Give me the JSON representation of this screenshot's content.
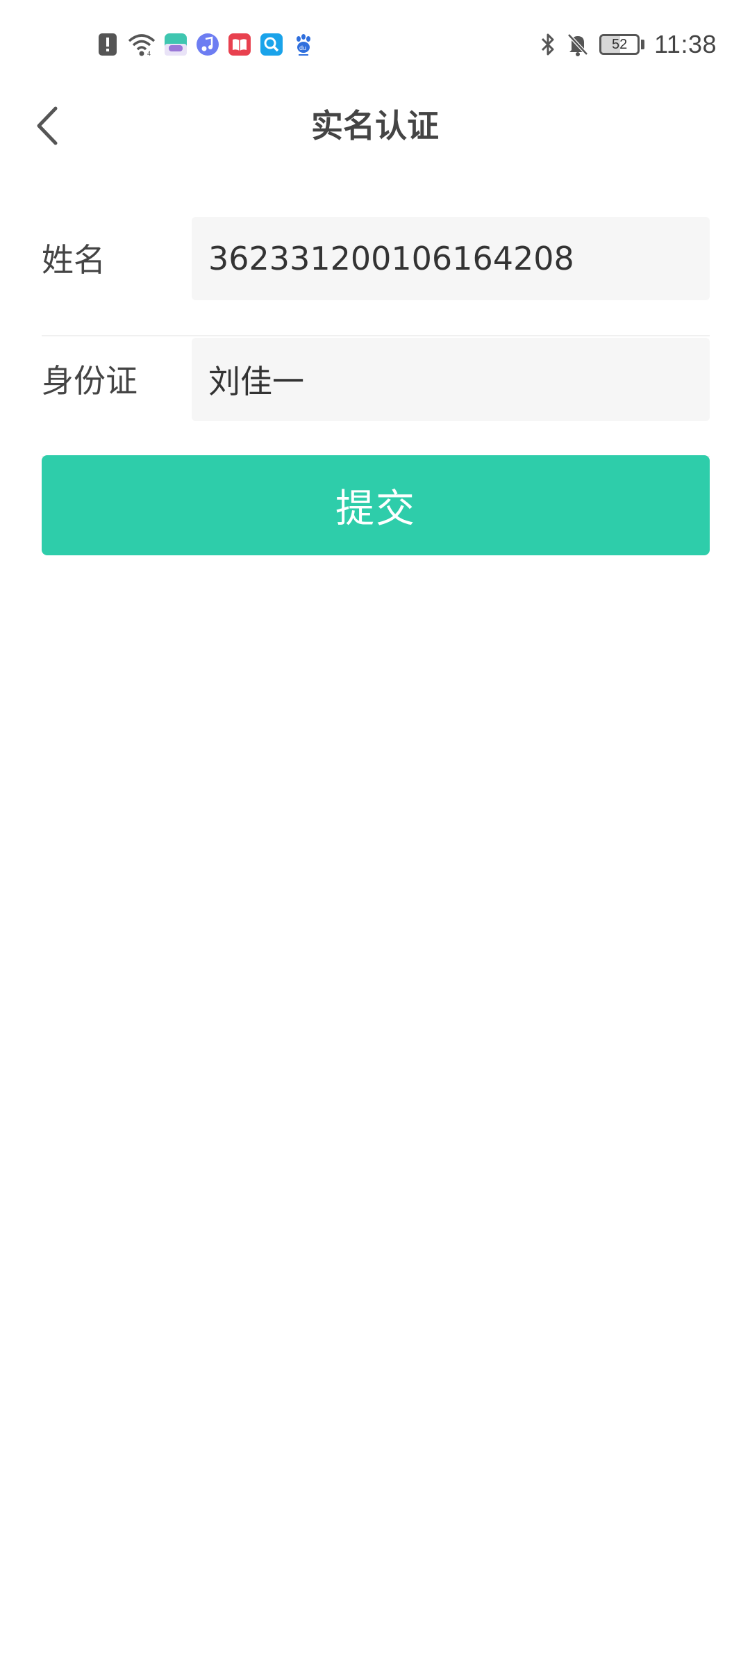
{
  "status_bar": {
    "left_icons": [
      "alert-icon",
      "wifi-icon",
      "game-app-icon",
      "music-app-icon",
      "book-app-icon",
      "search-app-icon",
      "baidu-app-icon"
    ],
    "right_icons": [
      "bluetooth-icon",
      "bell-off-icon"
    ],
    "battery_level": "52",
    "battery_percent": 52,
    "time": "11:38"
  },
  "header": {
    "title": "实名认证"
  },
  "form": {
    "name_label": "姓名",
    "name_value": "362331200106164208",
    "id_label": "身份证",
    "id_value": "刘佳一"
  },
  "actions": {
    "submit_label": "提交"
  },
  "colors": {
    "accent": "#2ecdaa",
    "input_bg": "#f6f6f6",
    "divider": "#f0f0f0"
  }
}
